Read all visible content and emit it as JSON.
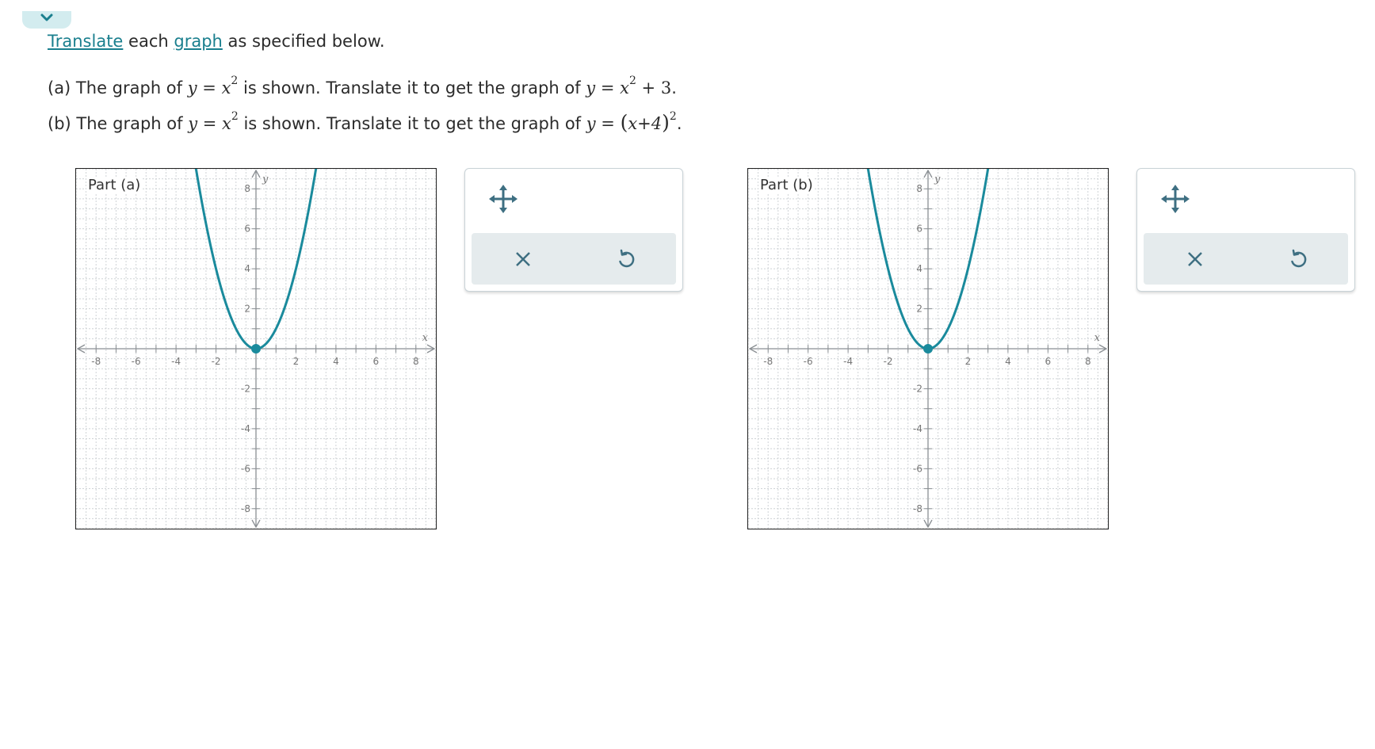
{
  "collapse_toggle": {
    "icon": "chevron-down-icon",
    "color": "#1a7f8e"
  },
  "instructions": {
    "link1": "Translate",
    "mid": " each ",
    "link2": "graph",
    "tail": " as specified below."
  },
  "questions": [
    {
      "prefix": "(a) The graph of ",
      "middle": " is shown. Translate it to get the graph of ",
      "shown_equation": "y = x^2",
      "target_equation": "y = x^2 + 3"
    },
    {
      "prefix": "(b) The graph of ",
      "middle": " is shown. Translate it to get the graph of ",
      "shown_equation": "y = x^2",
      "target_equation": "y = (x+4)^2"
    }
  ],
  "math": {
    "y": "y",
    "eq": " = ",
    "x": "x",
    "sq": "2",
    "plus3": " + 3",
    "period": ".",
    "lp": "(",
    "x4": "x+4",
    "rp": ")"
  },
  "graphs": [
    {
      "label": "Part (a)",
      "curve_color": "#1a8a9c"
    },
    {
      "label": "Part (b)",
      "curve_color": "#1a8a9c"
    }
  ],
  "chart_data": [
    {
      "type": "line",
      "title": "Part (a)",
      "xlabel": "x",
      "ylabel": "y",
      "xlim": [
        -9,
        9
      ],
      "ylim": [
        -9,
        9
      ],
      "x_ticks": [
        -8,
        -6,
        -4,
        -2,
        2,
        4,
        6,
        8
      ],
      "y_ticks": [
        -8,
        -6,
        -4,
        -2,
        2,
        4,
        6,
        8
      ],
      "grid": true,
      "function": "y = x^2",
      "vertex": [
        0,
        0
      ]
    },
    {
      "type": "line",
      "title": "Part (b)",
      "xlabel": "x",
      "ylabel": "y",
      "xlim": [
        -9,
        9
      ],
      "ylim": [
        -9,
        9
      ],
      "x_ticks": [
        -8,
        -6,
        -4,
        -2,
        2,
        4,
        6,
        8
      ],
      "y_ticks": [
        -8,
        -6,
        -4,
        -2,
        2,
        4,
        6,
        8
      ],
      "grid": true,
      "function": "y = x^2",
      "vertex": [
        0,
        0
      ]
    }
  ],
  "toolboxes": [
    {
      "move_icon": "move-arrows-icon",
      "clear_icon": "close-icon",
      "undo_icon": "undo-icon",
      "icon_color": "#3e6f82"
    },
    {
      "move_icon": "move-arrows-icon",
      "clear_icon": "close-icon",
      "undo_icon": "undo-icon",
      "icon_color": "#3e6f82"
    }
  ]
}
